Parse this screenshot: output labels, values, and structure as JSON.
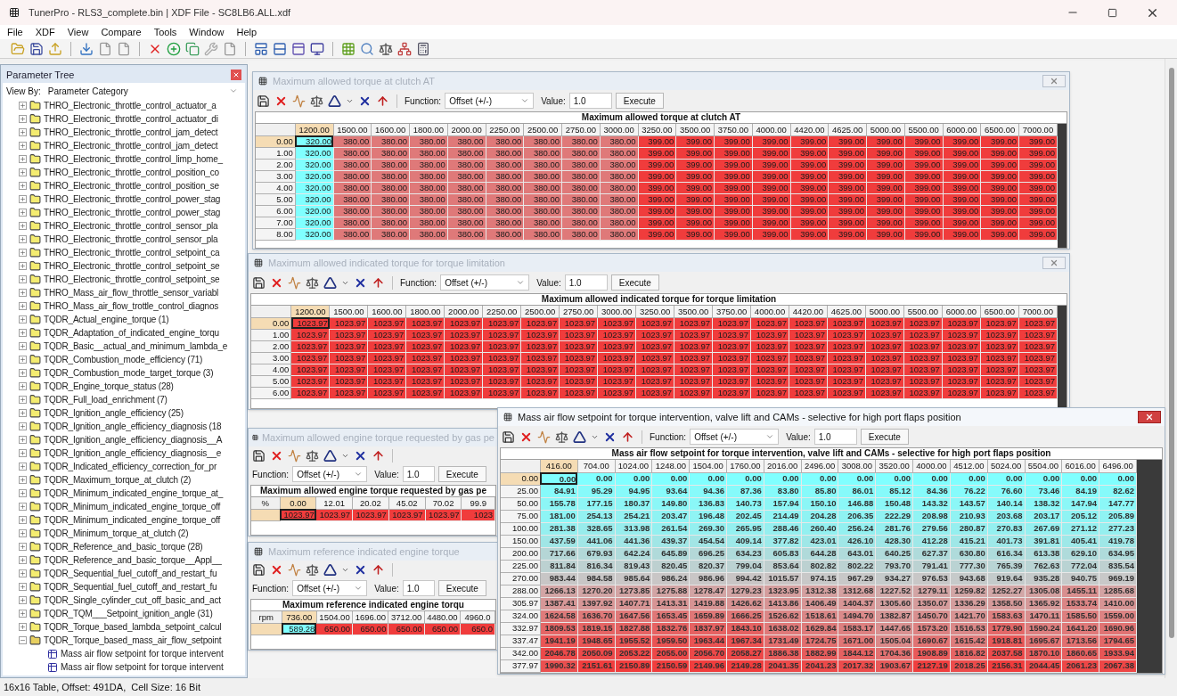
{
  "window": {
    "title": "TunerPro - RLS3_complete.bin | XDF File - SC8LB6.ALL.xdf"
  },
  "menu": [
    "File",
    "XDF",
    "View",
    "Compare",
    "Tools",
    "Window",
    "Help"
  ],
  "parameter_tree": {
    "title": "Parameter Tree",
    "view_by_label": "View By:",
    "view_by_value": "Parameter Category",
    "items": [
      {
        "label": "THRO_Electronic_throttle_control_actuator_a",
        "expanded": false
      },
      {
        "label": "THRO_Electronic_throttle_control_actuator_di",
        "expanded": false
      },
      {
        "label": "THRO_Electronic_throttle_control_jam_detect",
        "expanded": false
      },
      {
        "label": "THRO_Electronic_throttle_control_jam_detect",
        "expanded": false
      },
      {
        "label": "THRO_Electronic_throttle_control_limp_home_",
        "expanded": false
      },
      {
        "label": "THRO_Electronic_throttle_control_position_co",
        "expanded": false
      },
      {
        "label": "THRO_Electronic_throttle_control_position_se",
        "expanded": false
      },
      {
        "label": "THRO_Electronic_throttle_control_power_stag",
        "expanded": false
      },
      {
        "label": "THRO_Electronic_throttle_control_power_stag",
        "expanded": false
      },
      {
        "label": "THRO_Electronic_throttle_control_sensor_pla",
        "expanded": false
      },
      {
        "label": "THRO_Electronic_throttle_control_sensor_pla",
        "expanded": false
      },
      {
        "label": "THRO_Electronic_throttle_control_setpoint_ca",
        "expanded": false
      },
      {
        "label": "THRO_Electronic_throttle_control_setpoint_se",
        "expanded": false
      },
      {
        "label": "THRO_Electronic_throttle_control_setpoint_se",
        "expanded": false
      },
      {
        "label": "THRO_Mass_air_flow_throttle_sensor_variabl",
        "expanded": false
      },
      {
        "label": "THRO_Mass_air_flow_trottle_control_diagnos",
        "expanded": false
      },
      {
        "label": "TQDR_Actual_engine_torque (1)",
        "expanded": false
      },
      {
        "label": "TQDR_Adaptation_of_indicated_engine_torqu",
        "expanded": false
      },
      {
        "label": "TQDR_Basic__actual_and_minimum_lambda_e",
        "expanded": false
      },
      {
        "label": "TQDR_Combustion_mode_efficiency (71)",
        "expanded": false
      },
      {
        "label": "TQDR_Combustion_mode_target_torque (3)",
        "expanded": false
      },
      {
        "label": "TQDR_Engine_torque_status (28)",
        "expanded": false
      },
      {
        "label": "TQDR_Full_load_enrichment (7)",
        "expanded": false
      },
      {
        "label": "TQDR_Ignition_angle_efficiency (25)",
        "expanded": false
      },
      {
        "label": "TQDR_Ignition_angle_efficiency_diagnosis (18",
        "expanded": false
      },
      {
        "label": "TQDR_Ignition_angle_efficiency_diagnosis__A",
        "expanded": false
      },
      {
        "label": "TQDR_Ignition_angle_efficiency_diagnosis__e",
        "expanded": false
      },
      {
        "label": "TQDR_Indicated_efficiency_correction_for_pr",
        "expanded": false
      },
      {
        "label": "TQDR_Maximum_torque_at_clutch (2)",
        "expanded": false
      },
      {
        "label": "TQDR_Minimum_indicated_engine_torque_at_",
        "expanded": false
      },
      {
        "label": "TQDR_Minimum_indicated_engine_torque_off",
        "expanded": false
      },
      {
        "label": "TQDR_Minimum_indicated_engine_torque_off",
        "expanded": false
      },
      {
        "label": "TQDR_Minimum_torque_at_clutch (2)",
        "expanded": false
      },
      {
        "label": "TQDR_Reference_and_basic_torque (28)",
        "expanded": false
      },
      {
        "label": "TQDR_Reference_and_basic_torque__Appl__",
        "expanded": false
      },
      {
        "label": "TQDR_Sequential_fuel_cutoff_and_restart_fu",
        "expanded": false
      },
      {
        "label": "TQDR_Sequential_fuel_cutoff_and_restart_fu",
        "expanded": false
      },
      {
        "label": "TQDR_Single_cylinder_cut_off_basic_and_act",
        "expanded": false
      },
      {
        "label": "TQDR_TQM___Setpoint_ignition_angle (31)",
        "expanded": false
      },
      {
        "label": "TQDR_Torque_based_lambda_setpoint_calcul",
        "expanded": false
      },
      {
        "label": "TQDR_Torque_based_mass_air_flow_setpoint",
        "expanded": true,
        "children": [
          {
            "label": "Mass air flow setpoint for torque intervent"
          },
          {
            "label": "Mass air flow setpoint for torque intervent"
          }
        ]
      }
    ]
  },
  "windows": [
    {
      "title": "Maximum allowed torque at clutch AT",
      "active": false,
      "close_visible": true,
      "toolbar": {
        "function_label": "Function:",
        "function_value": "Offset (+/-)",
        "value_label": "Value:",
        "value": "1.0",
        "execute": "Execute"
      },
      "table": {
        "title": "Maximum allowed torque at clutch AT",
        "columns": [
          {
            "label": "1200.00",
            "selected": true
          },
          {
            "label": "1500.00",
            "selected": false
          },
          {
            "label": "1600.00",
            "selected": false
          },
          {
            "label": "1800.00",
            "selected": false
          },
          {
            "label": "2000.00",
            "selected": false
          },
          {
            "label": "2250.00",
            "selected": false
          },
          {
            "label": "2500.00",
            "selected": false
          },
          {
            "label": "2750.00",
            "selected": false
          },
          {
            "label": "3000.00",
            "selected": false
          },
          {
            "label": "3250.00",
            "selected": false
          },
          {
            "label": "3500.00",
            "selected": false
          },
          {
            "label": "3750.00",
            "selected": false
          },
          {
            "label": "4000.00",
            "selected": false
          },
          {
            "label": "4420.00",
            "selected": false
          },
          {
            "label": "4625.00",
            "selected": false
          },
          {
            "label": "5000.00",
            "selected": false
          },
          {
            "label": "5500.00",
            "selected": false
          },
          {
            "label": "6000.00",
            "selected": false
          },
          {
            "label": "6500.00",
            "selected": false
          },
          {
            "label": "7000.00",
            "selected": false
          }
        ],
        "rows": [
          {
            "label": "0.00",
            "selected": true,
            "cells": [
              "320.00",
              "380.00",
              "380.00",
              "380.00",
              "380.00",
              "380.00",
              "380.00",
              "380.00",
              "380.00",
              "399.00",
              "399.00",
              "399.00",
              "399.00",
              "399.00",
              "399.00",
              "399.00",
              "399.00",
              "399.00",
              "399.00",
              "399.00"
            ]
          },
          {
            "label": "1.00",
            "selected": false,
            "cells": [
              "320.00",
              "380.00",
              "380.00",
              "380.00",
              "380.00",
              "380.00",
              "380.00",
              "380.00",
              "380.00",
              "399.00",
              "399.00",
              "399.00",
              "399.00",
              "399.00",
              "399.00",
              "399.00",
              "399.00",
              "399.00",
              "399.00",
              "399.00"
            ]
          },
          {
            "label": "2.00",
            "selected": false,
            "cells": [
              "320.00",
              "380.00",
              "380.00",
              "380.00",
              "380.00",
              "380.00",
              "380.00",
              "380.00",
              "380.00",
              "399.00",
              "399.00",
              "399.00",
              "399.00",
              "399.00",
              "399.00",
              "399.00",
              "399.00",
              "399.00",
              "399.00",
              "399.00"
            ]
          },
          {
            "label": "3.00",
            "selected": false,
            "cells": [
              "320.00",
              "380.00",
              "380.00",
              "380.00",
              "380.00",
              "380.00",
              "380.00",
              "380.00",
              "380.00",
              "399.00",
              "399.00",
              "399.00",
              "399.00",
              "399.00",
              "399.00",
              "399.00",
              "399.00",
              "399.00",
              "399.00",
              "399.00"
            ]
          },
          {
            "label": "4.00",
            "selected": false,
            "cells": [
              "320.00",
              "380.00",
              "380.00",
              "380.00",
              "380.00",
              "380.00",
              "380.00",
              "380.00",
              "380.00",
              "399.00",
              "399.00",
              "399.00",
              "399.00",
              "399.00",
              "399.00",
              "399.00",
              "399.00",
              "399.00",
              "399.00",
              "399.00"
            ]
          },
          {
            "label": "5.00",
            "selected": false,
            "cells": [
              "320.00",
              "380.00",
              "380.00",
              "380.00",
              "380.00",
              "380.00",
              "380.00",
              "380.00",
              "380.00",
              "399.00",
              "399.00",
              "399.00",
              "399.00",
              "399.00",
              "399.00",
              "399.00",
              "399.00",
              "399.00",
              "399.00",
              "399.00"
            ]
          },
          {
            "label": "6.00",
            "selected": false,
            "cells": [
              "320.00",
              "380.00",
              "380.00",
              "380.00",
              "380.00",
              "380.00",
              "380.00",
              "380.00",
              "380.00",
              "399.00",
              "399.00",
              "399.00",
              "399.00",
              "399.00",
              "399.00",
              "399.00",
              "399.00",
              "399.00",
              "399.00",
              "399.00"
            ]
          },
          {
            "label": "7.00",
            "selected": false,
            "cells": [
              "320.00",
              "380.00",
              "380.00",
              "380.00",
              "380.00",
              "380.00",
              "380.00",
              "380.00",
              "380.00",
              "399.00",
              "399.00",
              "399.00",
              "399.00",
              "399.00",
              "399.00",
              "399.00",
              "399.00",
              "399.00",
              "399.00",
              "399.00"
            ]
          },
          {
            "label": "8.00",
            "selected": false,
            "cells": [
              "320.00",
              "380.00",
              "380.00",
              "380.00",
              "380.00",
              "380.00",
              "380.00",
              "380.00",
              "380.00",
              "399.00",
              "399.00",
              "399.00",
              "399.00",
              "399.00",
              "399.00",
              "399.00",
              "399.00",
              "399.00",
              "399.00",
              "399.00"
            ]
          }
        ]
      }
    },
    {
      "title": "Maximum allowed indicated torque for torque limitation",
      "active": false,
      "close_visible": true,
      "toolbar": {
        "function_label": "Function:",
        "function_value": "Offset (+/-)",
        "value_label": "Value:",
        "value": "1.0",
        "execute": "Execute"
      },
      "table": {
        "title": "Maximum allowed indicated torque for torque limitation",
        "columns": [
          {
            "label": "1200.00",
            "selected": true
          },
          {
            "label": "1500.00",
            "selected": false
          },
          {
            "label": "1600.00",
            "selected": false
          },
          {
            "label": "1800.00",
            "selected": false
          },
          {
            "label": "2000.00",
            "selected": false
          },
          {
            "label": "2250.00",
            "selected": false
          },
          {
            "label": "2500.00",
            "selected": false
          },
          {
            "label": "2750.00",
            "selected": false
          },
          {
            "label": "3000.00",
            "selected": false
          },
          {
            "label": "3250.00",
            "selected": false
          },
          {
            "label": "3500.00",
            "selected": false
          },
          {
            "label": "3750.00",
            "selected": false
          },
          {
            "label": "4000.00",
            "selected": false
          },
          {
            "label": "4420.00",
            "selected": false
          },
          {
            "label": "4625.00",
            "selected": false
          },
          {
            "label": "5000.00",
            "selected": false
          },
          {
            "label": "5500.00",
            "selected": false
          },
          {
            "label": "6000.00",
            "selected": false
          },
          {
            "label": "6500.00",
            "selected": false
          },
          {
            "label": "7000.00",
            "selected": false
          }
        ],
        "rows": [
          {
            "label": "0.00",
            "selected": true,
            "cells": [
              "1023.97",
              "1023.97",
              "1023.97",
              "1023.97",
              "1023.97",
              "1023.97",
              "1023.97",
              "1023.97",
              "1023.97",
              "1023.97",
              "1023.97",
              "1023.97",
              "1023.97",
              "1023.97",
              "1023.97",
              "1023.97",
              "1023.97",
              "1023.97",
              "1023.97",
              "1023.97"
            ]
          },
          {
            "label": "1.00",
            "selected": false,
            "cells": [
              "1023.97",
              "1023.97",
              "1023.97",
              "1023.97",
              "1023.97",
              "1023.97",
              "1023.97",
              "1023.97",
              "1023.97",
              "1023.97",
              "1023.97",
              "1023.97",
              "1023.97",
              "1023.97",
              "1023.97",
              "1023.97",
              "1023.97",
              "1023.97",
              "1023.97",
              "1023.97"
            ]
          },
          {
            "label": "2.00",
            "selected": false,
            "cells": [
              "1023.97",
              "1023.97",
              "1023.97",
              "1023.97",
              "1023.97",
              "1023.97",
              "1023.97",
              "1023.97",
              "1023.97",
              "1023.97",
              "1023.97",
              "1023.97",
              "1023.97",
              "1023.97",
              "1023.97",
              "1023.97",
              "1023.97",
              "1023.97",
              "1023.97",
              "1023.97"
            ]
          },
          {
            "label": "3.00",
            "selected": false,
            "cells": [
              "1023.97",
              "1023.97",
              "1023.97",
              "1023.97",
              "1023.97",
              "1023.97",
              "1023.97",
              "1023.97",
              "1023.97",
              "1023.97",
              "1023.97",
              "1023.97",
              "1023.97",
              "1023.97",
              "1023.97",
              "1023.97",
              "1023.97",
              "1023.97",
              "1023.97",
              "1023.97"
            ]
          },
          {
            "label": "4.00",
            "selected": false,
            "cells": [
              "1023.97",
              "1023.97",
              "1023.97",
              "1023.97",
              "1023.97",
              "1023.97",
              "1023.97",
              "1023.97",
              "1023.97",
              "1023.97",
              "1023.97",
              "1023.97",
              "1023.97",
              "1023.97",
              "1023.97",
              "1023.97",
              "1023.97",
              "1023.97",
              "1023.97",
              "1023.97"
            ]
          },
          {
            "label": "5.00",
            "selected": false,
            "cells": [
              "1023.97",
              "1023.97",
              "1023.97",
              "1023.97",
              "1023.97",
              "1023.97",
              "1023.97",
              "1023.97",
              "1023.97",
              "1023.97",
              "1023.97",
              "1023.97",
              "1023.97",
              "1023.97",
              "1023.97",
              "1023.97",
              "1023.97",
              "1023.97",
              "1023.97",
              "1023.97"
            ]
          },
          {
            "label": "6.00",
            "selected": false,
            "cells": [
              "1023.97",
              "1023.97",
              "1023.97",
              "1023.97",
              "1023.97",
              "1023.97",
              "1023.97",
              "1023.97",
              "1023.97",
              "1023.97",
              "1023.97",
              "1023.97",
              "1023.97",
              "1023.97",
              "1023.97",
              "1023.97",
              "1023.97",
              "1023.97",
              "1023.97",
              "1023.97"
            ]
          }
        ]
      }
    },
    {
      "title": "Maximum allowed engine torque requested by gas pe",
      "active": false,
      "close_visible": false,
      "toolbar": {
        "function_label": "Function:",
        "function_value": "Offset (+/-)",
        "value_label": "Value:",
        "value": "1.0",
        "execute": "Execute"
      },
      "table": {
        "title": "Maximum allowed engine torque requested by gas pe",
        "corner": "%",
        "columns": [
          {
            "label": "0.00",
            "selected": true
          },
          {
            "label": "12.01",
            "selected": false
          },
          {
            "label": "20.02",
            "selected": false
          },
          {
            "label": "45.02",
            "selected": false
          },
          {
            "label": "70.02",
            "selected": false
          },
          {
            "label": "99.9",
            "selected": false
          }
        ],
        "rows": [
          {
            "selected": true,
            "cells": [
              "1023.97",
              "1023.97",
              "1023.97",
              "1023.97",
              "1023.97",
              "1023"
            ]
          }
        ]
      }
    },
    {
      "title": "Maximum reference indicated engine torque",
      "active": false,
      "close_visible": false,
      "toolbar": {
        "function_label": "Function:",
        "function_value": "Offset (+/-)",
        "value_label": "Value:",
        "value": "1.0",
        "execute": "Execute"
      },
      "table": {
        "title": "Maximum reference indicated engine torqu",
        "corner": "rpm",
        "columns": [
          {
            "label": "736.00",
            "selected": true
          },
          {
            "label": "1504.00",
            "selected": false
          },
          {
            "label": "1696.00",
            "selected": false
          },
          {
            "label": "3712.00",
            "selected": false
          },
          {
            "label": "4480.00",
            "selected": false
          },
          {
            "label": "4960.0",
            "selected": false
          }
        ],
        "rows": [
          {
            "selected": true,
            "cells": [
              "589.28",
              "650.00",
              "650.00",
              "650.00",
              "650.00",
              "650.0"
            ]
          }
        ]
      }
    },
    {
      "title": "Mass air flow setpoint for torque intervention, valve lift and CAMs - selective for high port flaps position",
      "active": true,
      "close_visible": true,
      "toolbar": {
        "function_label": "Function:",
        "function_value": "Offset (+/-)",
        "value_label": "Value:",
        "value": "1.0",
        "execute": "Execute"
      },
      "table": {
        "title": "Mass air flow setpoint for torque intervention, valve lift and CAMs - selective for high port flaps position",
        "columns": [
          {
            "label": "416.00",
            "selected": true
          },
          {
            "label": "704.00",
            "selected": false
          },
          {
            "label": "1024.00",
            "selected": false
          },
          {
            "label": "1248.00",
            "selected": false
          },
          {
            "label": "1504.00",
            "selected": false
          },
          {
            "label": "1760.00",
            "selected": false
          },
          {
            "label": "2016.00",
            "selected": false
          },
          {
            "label": "2496.00",
            "selected": false
          },
          {
            "label": "3008.00",
            "selected": false
          },
          {
            "label": "3520.00",
            "selected": false
          },
          {
            "label": "4000.00",
            "selected": false
          },
          {
            "label": "4512.00",
            "selected": false
          },
          {
            "label": "5024.00",
            "selected": false
          },
          {
            "label": "5504.00",
            "selected": false
          },
          {
            "label": "6016.00",
            "selected": false
          },
          {
            "label": "6496.00",
            "selected": false
          }
        ],
        "rows": [
          {
            "label": "0.00",
            "selected": true,
            "cells": [
              "0.00",
              "0.00",
              "0.00",
              "0.00",
              "0.00",
              "0.00",
              "0.00",
              "0.00",
              "0.00",
              "0.00",
              "0.00",
              "0.00",
              "0.00",
              "0.00",
              "0.00",
              "0.00"
            ]
          },
          {
            "label": "25.00",
            "selected": false,
            "cells": [
              "84.91",
              "95.29",
              "94.95",
              "93.64",
              "94.36",
              "87.36",
              "83.80",
              "85.80",
              "86.01",
              "85.12",
              "84.36",
              "76.22",
              "76.60",
              "73.46",
              "84.19",
              "82.62"
            ]
          },
          {
            "label": "50.00",
            "selected": false,
            "cells": [
              "155.78",
              "177.15",
              "180.37",
              "149.80",
              "136.83",
              "140.73",
              "157.94",
              "150.10",
              "146.88",
              "150.48",
              "143.32",
              "143.57",
              "140.14",
              "138.32",
              "147.94",
              "147.77"
            ]
          },
          {
            "label": "75.00",
            "selected": false,
            "cells": [
              "181.00",
              "254.13",
              "254.21",
              "203.47",
              "196.48",
              "202.45",
              "214.49",
              "204.28",
              "206.35",
              "222.29",
              "208.98",
              "210.93",
              "203.68",
              "203.17",
              "205.12",
              "205.89"
            ]
          },
          {
            "label": "100.00",
            "selected": false,
            "cells": [
              "281.38",
              "328.65",
              "313.98",
              "261.54",
              "269.30",
              "265.95",
              "288.46",
              "260.40",
              "256.24",
              "281.76",
              "279.56",
              "280.87",
              "270.83",
              "267.69",
              "271.12",
              "277.23"
            ]
          },
          {
            "label": "150.00",
            "selected": false,
            "cells": [
              "437.59",
              "441.06",
              "441.36",
              "439.37",
              "454.54",
              "409.14",
              "377.82",
              "423.01",
              "426.10",
              "428.30",
              "412.28",
              "415.21",
              "401.73",
              "391.81",
              "405.41",
              "419.78"
            ]
          },
          {
            "label": "200.00",
            "selected": false,
            "cells": [
              "717.66",
              "679.93",
              "642.24",
              "645.89",
              "696.25",
              "634.23",
              "605.83",
              "644.28",
              "643.01",
              "640.25",
              "627.37",
              "630.80",
              "616.34",
              "613.38",
              "629.10",
              "634.95"
            ]
          },
          {
            "label": "225.00",
            "selected": false,
            "cells": [
              "811.84",
              "816.34",
              "819.43",
              "820.45",
              "820.37",
              "799.04",
              "853.64",
              "802.82",
              "802.22",
              "793.70",
              "791.41",
              "777.30",
              "765.39",
              "762.63",
              "772.04",
              "835.54"
            ]
          },
          {
            "label": "270.00",
            "selected": false,
            "cells": [
              "983.44",
              "984.58",
              "985.64",
              "986.24",
              "986.96",
              "994.42",
              "1015.57",
              "974.15",
              "967.29",
              "934.27",
              "976.53",
              "943.68",
              "919.64",
              "935.28",
              "940.75",
              "969.19"
            ]
          },
          {
            "label": "288.00",
            "selected": false,
            "cells": [
              "1266.13",
              "1270.20",
              "1273.85",
              "1275.88",
              "1278.47",
              "1279.23",
              "1323.95",
              "1312.38",
              "1312.68",
              "1227.52",
              "1279.11",
              "1259.82",
              "1252.27",
              "1305.08",
              "1455.11",
              "1285.68"
            ]
          },
          {
            "label": "305.97",
            "selected": false,
            "cells": [
              "1387.41",
              "1397.92",
              "1407.71",
              "1413.31",
              "1419.88",
              "1426.62",
              "1413.86",
              "1406.49",
              "1404.37",
              "1305.60",
              "1350.07",
              "1336.29",
              "1358.50",
              "1365.92",
              "1533.74",
              "1410.00"
            ]
          },
          {
            "label": "324.00",
            "selected": false,
            "cells": [
              "1624.58",
              "1636.70",
              "1647.56",
              "1653.45",
              "1659.89",
              "1666.25",
              "1526.62",
              "1518.61",
              "1494.70",
              "1382.87",
              "1450.70",
              "1421.70",
              "1583.63",
              "1470.11",
              "1585.50",
              "1559.00"
            ]
          },
          {
            "label": "332.97",
            "selected": false,
            "cells": [
              "1809.53",
              "1819.15",
              "1827.88",
              "1832.76",
              "1837.97",
              "1843.10",
              "1638.02",
              "1629.84",
              "1583.17",
              "1447.65",
              "1573.20",
              "1516.53",
              "1779.90",
              "1590.24",
              "1641.20",
              "1690.96"
            ]
          },
          {
            "label": "337.47",
            "selected": false,
            "cells": [
              "1941.19",
              "1948.65",
              "1955.52",
              "1959.50",
              "1963.44",
              "1967.34",
              "1731.49",
              "1724.75",
              "1671.00",
              "1505.04",
              "1690.67",
              "1615.42",
              "1918.81",
              "1695.67",
              "1713.56",
              "1794.65"
            ]
          },
          {
            "label": "342.00",
            "selected": false,
            "cells": [
              "2046.78",
              "2050.09",
              "2053.22",
              "2055.00",
              "2056.70",
              "2058.27",
              "1886.38",
              "1882.99",
              "1844.12",
              "1704.36",
              "1908.89",
              "1816.82",
              "2037.58",
              "1870.10",
              "1860.65",
              "1933.94"
            ]
          },
          {
            "label": "377.97",
            "selected": false,
            "cells": [
              "1990.32",
              "2151.61",
              "2150.89",
              "2150.59",
              "2149.96",
              "2149.28",
              "2041.35",
              "2041.23",
              "2017.32",
              "1903.67",
              "2127.19",
              "2018.25",
              "2156.31",
              "2044.45",
              "2061.23",
              "2067.38"
            ]
          }
        ]
      }
    }
  ],
  "status_bar": "16x16 Table, Offset: 491DA,  Cell Size: 16 Bit"
}
